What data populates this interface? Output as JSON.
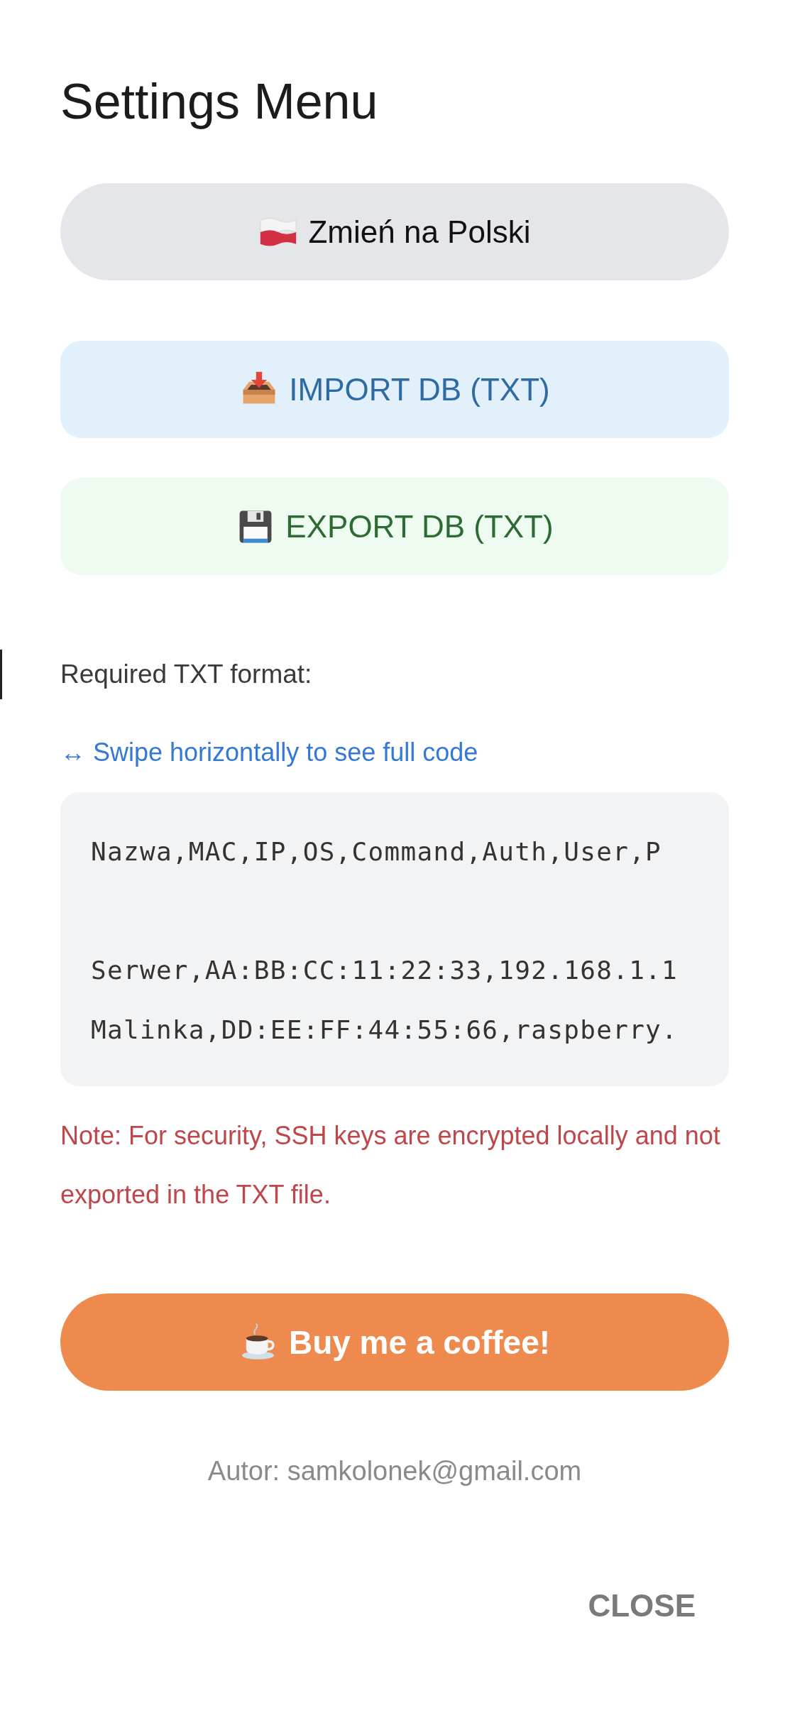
{
  "dialog": {
    "title": "Settings Menu",
    "buttons": [
      {
        "kind": "language",
        "label": "Zmień na Polski"
      },
      {
        "kind": "import",
        "label": "IMPORT DB (TXT)"
      },
      {
        "kind": "export",
        "label": "EXPORT DB (TXT)"
      }
    ],
    "format": {
      "heading": "Required TXT format:",
      "hint": "↔ Swipe horizontally to see full code",
      "code_lines": [
        {
          "kind": "header",
          "text": "Nazwa,MAC,IP,OS,Command,Auth,User,P"
        },
        {
          "kind": "row",
          "text": "Serwer,AA:BB:CC:11:22:33,192.168.1.1"
        },
        {
          "kind": "row",
          "text": "Malinka,DD:EE:FF:44:55:66,raspberry."
        }
      ]
    },
    "note": "Note: For security, SSH keys are encrypted locally and not exported in the TXT file.",
    "coffee_button": {
      "label": "Buy me a coffee!"
    },
    "author": "Autor: samkolonek@gmail.com",
    "close_button": {
      "label": "CLOSE"
    }
  }
}
